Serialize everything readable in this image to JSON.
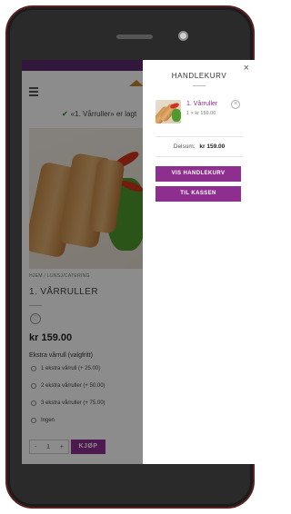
{
  "page": {
    "notice": "«1. Vårruller» er lagt",
    "logo_text": "",
    "breadcrumb": "HJEM / LUNSJ/CATERING",
    "product_title": "1. VÅRRULLER",
    "price": "kr 159.00",
    "extra_label": "Ekstra vårrull (valgfritt)",
    "options": [
      "1 ekstra vårrull (+ 25.00)",
      "2 ekstra vårruller (+ 50.00)",
      "3 ekstra vårruller (+ 75.00)",
      "Ingen"
    ],
    "qty_minus": "-",
    "qty_value": "1",
    "qty_plus": "+",
    "buy_label": "KJØP"
  },
  "cart": {
    "title": "HANDLEKURV",
    "close": "×",
    "item_name": "1. Vårruller",
    "item_qty": "1 × kr 159.00",
    "remove": "×",
    "subtotal_label": "Delsum:",
    "subtotal_value": "kr 159.00",
    "view_cart": "VIS HANDLEKURV",
    "checkout": "TIL KASSEN"
  },
  "colors": {
    "brand": "#8e2e8e",
    "topbar": "#5b2a6e",
    "check": "#3c9b3c"
  }
}
